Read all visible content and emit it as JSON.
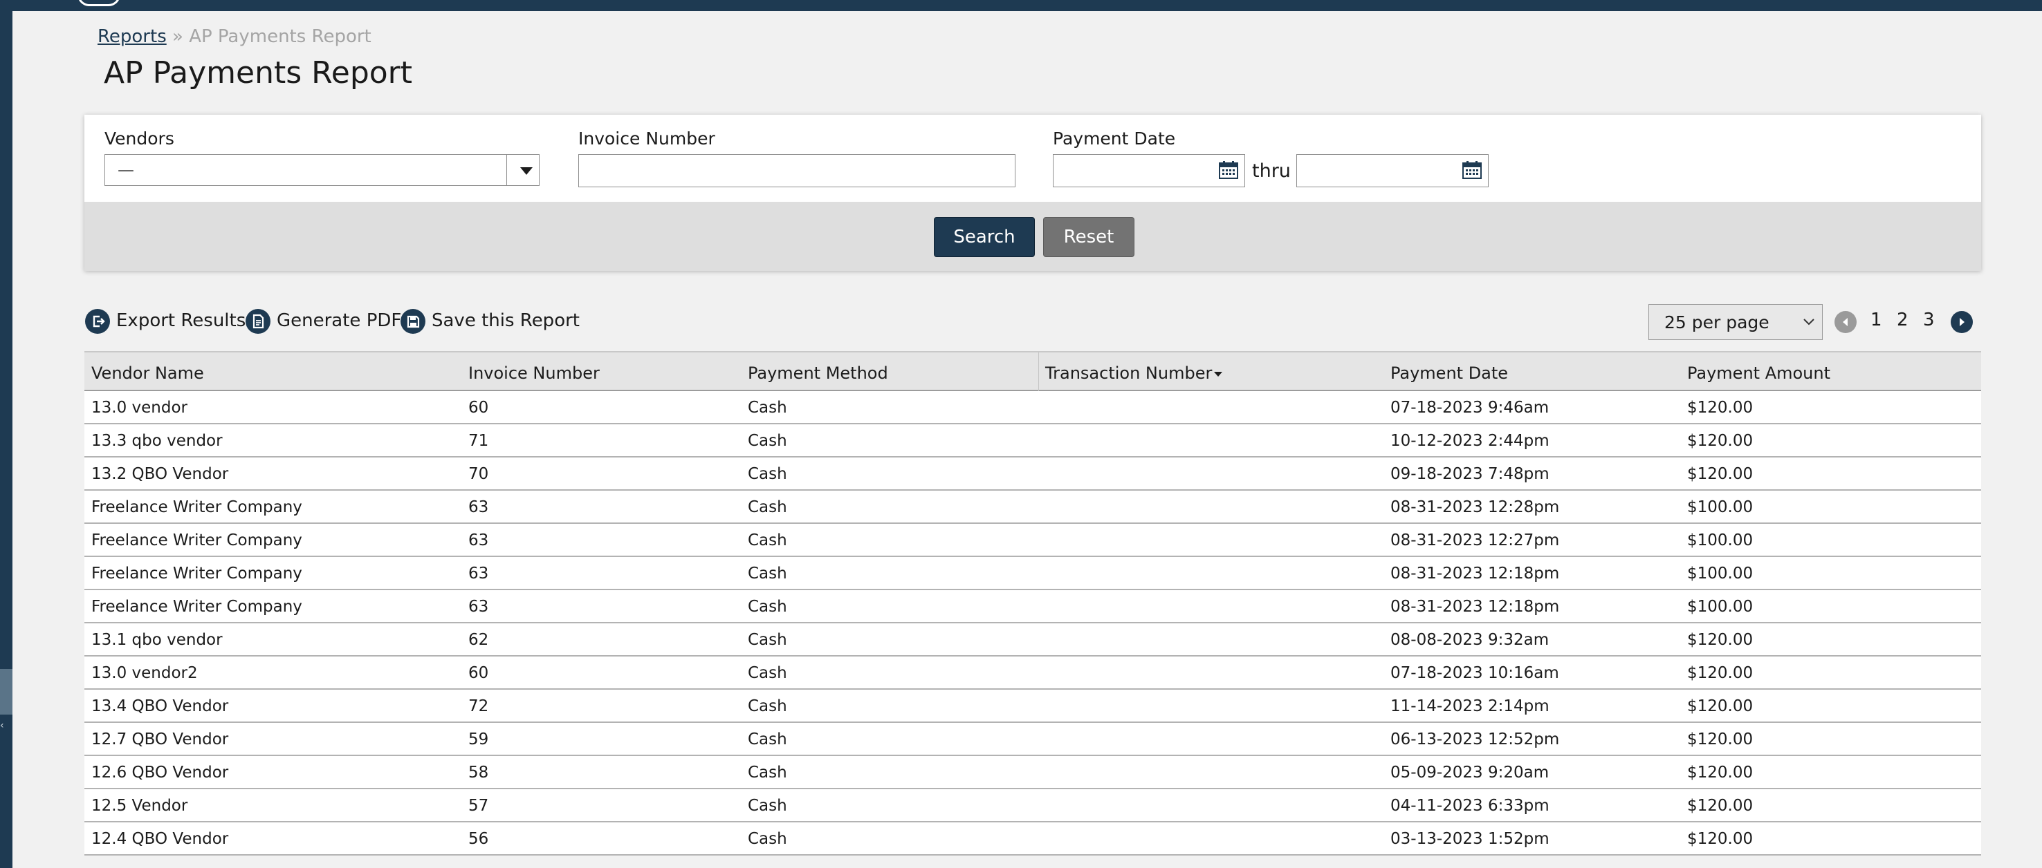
{
  "breadcrumb": {
    "link": "Reports",
    "separator": "»",
    "current": "AP Payments Report"
  },
  "page_title": "AP Payments Report",
  "filters": {
    "vendors_label": "Vendors",
    "vendors_value": "—",
    "invoice_label": "Invoice Number",
    "invoice_value": "",
    "payment_date_label": "Payment Date",
    "date_from": "",
    "date_to": "",
    "thru": "thru"
  },
  "buttons": {
    "search": "Search",
    "reset": "Reset"
  },
  "actions": {
    "export": "Export Results",
    "pdf": "Generate PDF",
    "save": "Save this Report"
  },
  "pagination": {
    "per_page": "25 per page",
    "pages": [
      "1",
      "2",
      "3"
    ]
  },
  "table": {
    "headers": [
      "Vendor Name",
      "Invoice Number",
      "Payment Method",
      "Transaction Number",
      "Payment Date",
      "Payment Amount"
    ],
    "sorted_column": "Transaction Number",
    "rows": [
      [
        "13.0 vendor",
        "60",
        "Cash",
        "",
        "07-18-2023 9:46am",
        "$120.00"
      ],
      [
        "13.3 qbo vendor",
        "71",
        "Cash",
        "",
        "10-12-2023 2:44pm",
        "$120.00"
      ],
      [
        "13.2 QBO Vendor",
        "70",
        "Cash",
        "",
        "09-18-2023 7:48pm",
        "$120.00"
      ],
      [
        "Freelance Writer Company",
        "63",
        "Cash",
        "",
        "08-31-2023 12:28pm",
        "$100.00"
      ],
      [
        "Freelance Writer Company",
        "63",
        "Cash",
        "",
        "08-31-2023 12:27pm",
        "$100.00"
      ],
      [
        "Freelance Writer Company",
        "63",
        "Cash",
        "",
        "08-31-2023 12:18pm",
        "$100.00"
      ],
      [
        "Freelance Writer Company",
        "63",
        "Cash",
        "",
        "08-31-2023 12:18pm",
        "$100.00"
      ],
      [
        "13.1 qbo vendor",
        "62",
        "Cash",
        "",
        "08-08-2023 9:32am",
        "$120.00"
      ],
      [
        "13.0 vendor2",
        "60",
        "Cash",
        "",
        "07-18-2023 10:16am",
        "$120.00"
      ],
      [
        "13.4 QBO Vendor",
        "72",
        "Cash",
        "",
        "11-14-2023 2:14pm",
        "$120.00"
      ],
      [
        "12.7 QBO Vendor",
        "59",
        "Cash",
        "",
        "06-13-2023 12:52pm",
        "$120.00"
      ],
      [
        "12.6 QBO Vendor",
        "58",
        "Cash",
        "",
        "05-09-2023 9:20am",
        "$120.00"
      ],
      [
        "12.5 Vendor",
        "57",
        "Cash",
        "",
        "04-11-2023 6:33pm",
        "$120.00"
      ],
      [
        "12.4 QBO Vendor",
        "56",
        "Cash",
        "",
        "03-13-2023 1:52pm",
        "$120.00"
      ]
    ]
  },
  "colors": {
    "brand": "#1e3a52",
    "reset_button": "#737373",
    "page_bg": "#f1f1f1"
  }
}
